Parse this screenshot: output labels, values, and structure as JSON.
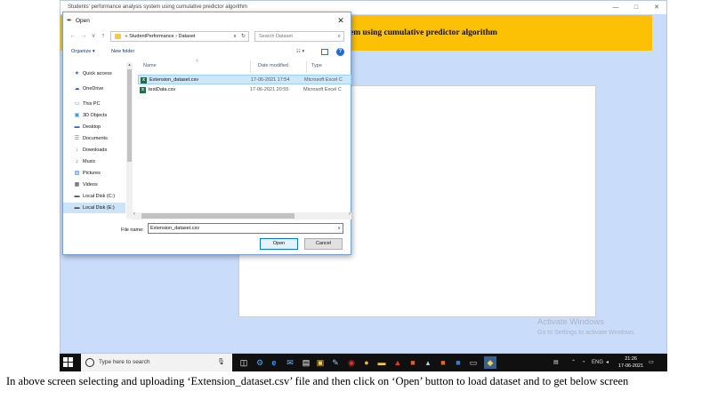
{
  "app": {
    "title": "Students' performance analysis system using cumulative predictor algorithm",
    "banner_title": "em using cumulative predictor algorithm",
    "window_controls": [
      "—",
      "□",
      "✕"
    ],
    "watermark_title": "Activate Windows",
    "watermark_sub": "Go to Settings to activate Windows."
  },
  "dialog": {
    "title": "Open",
    "close": "✕",
    "address": {
      "prefix": "«",
      "path": [
        "StudentPerformance",
        "Dataset"
      ],
      "separator": "›"
    },
    "search_placeholder": "Search Dataset",
    "toolbar": {
      "organize": "Organize ▾",
      "new_folder": "New folder"
    },
    "nav_items": [
      {
        "label": "Quick access",
        "icon": "star-icon"
      },
      {
        "label": "OneDrive",
        "icon": "cloud-icon"
      },
      {
        "label": "This PC",
        "icon": "pc-icon"
      },
      {
        "label": "3D Objects",
        "icon": "cube-icon"
      },
      {
        "label": "Desktop",
        "icon": "desktop-icon"
      },
      {
        "label": "Documents",
        "icon": "document-icon"
      },
      {
        "label": "Downloads",
        "icon": "download-icon"
      },
      {
        "label": "Music",
        "icon": "music-icon"
      },
      {
        "label": "Pictures",
        "icon": "picture-icon"
      },
      {
        "label": "Videos",
        "icon": "video-icon"
      },
      {
        "label": "Local Disk (C:)",
        "icon": "drive-icon"
      },
      {
        "label": "Local Disk (E:)",
        "icon": "drive-icon"
      }
    ],
    "columns": {
      "name": "Name",
      "date": "Date modified",
      "type": "Type"
    },
    "files": [
      {
        "name": "Extension_dataset.csv",
        "date": "17-06-2021 17:54",
        "type": "Microsoft Excel C"
      },
      {
        "name": "testData.csv",
        "date": "17-06-2021 20:55",
        "type": "Microsoft Excel C"
      }
    ],
    "file_name_label": "File name:",
    "file_name_value": "Extension_dataset.csv",
    "open_label": "Open",
    "cancel_label": "Cancel"
  },
  "taskbar": {
    "search_placeholder": "Type here to search",
    "time": "21:26",
    "date": "17-06-2021",
    "lang": "ENG"
  },
  "caption": "In above screen selecting and uploading ‘Extension_dataset.csv’ file and then click on ‘Open’ button to load dataset and to get below screen"
}
